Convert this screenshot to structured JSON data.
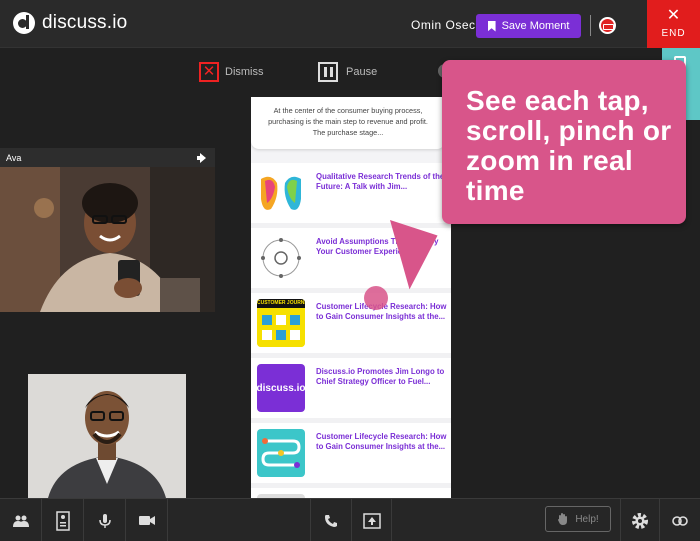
{
  "header": {
    "logo_text": "discuss.io",
    "user_name": "Omin Osec",
    "save_label": "Save Moment",
    "end_label": "END",
    "end_icon": "✕"
  },
  "toolbar": {
    "dismiss_label": "Dismiss",
    "pause_label": "Pause"
  },
  "participants": [
    {
      "name": "Ava"
    }
  ],
  "phone_screen": {
    "intro_text": "At the center of the consumer buying process, purchasing is the main step to revenue and profit. The purchase stage...",
    "articles": [
      {
        "title": "Qualitative Research Trends of the Future: A Talk with Jim..."
      },
      {
        "title": "Avoid Assumptions That Destroy Your Customer Experience"
      },
      {
        "title": "Customer Lifecycle Research: How to Gain Consumer Insights at the...",
        "thumb_label": "CUSTOMER JOURNEY"
      },
      {
        "title": "Discuss.io Promotes Jim Longo to Chief Strategy Officer to Fuel...",
        "thumb_label": "discuss.io"
      },
      {
        "title": "Customer Lifecycle Research: How to Gain Consumer Insights at the..."
      }
    ]
  },
  "callout": {
    "text": "See each tap, scroll, pinch or zoom in real time"
  },
  "bottom_bar": {
    "help_label": "Help!"
  },
  "colors": {
    "brand_purple": "#7b2fd6",
    "end_red": "#e11d1d",
    "callout_pink": "#d8558a",
    "teal": "#5ec7c6"
  }
}
